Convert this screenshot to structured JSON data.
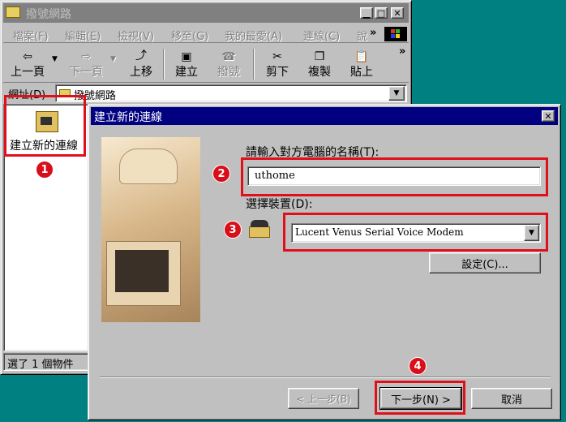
{
  "explorer": {
    "title": "撥號網路",
    "menu": [
      "檔案(F)",
      "編輯(E)",
      "檢視(V)",
      "移至(G)",
      "我的最愛(A)",
      "連線(C)",
      "說"
    ],
    "menu_more": "»",
    "toolbar": {
      "back": "上一頁",
      "forward": "下一頁",
      "up": "上移",
      "create": "建立",
      "dial": "撥號",
      "cut": "剪下",
      "copy": "複製",
      "paste": "貼上",
      "more": "»"
    },
    "address_label": "網址(D)",
    "address_value": "撥號網路",
    "icon_label": "建立新的連線",
    "status": "選了 1 個物件"
  },
  "dialog": {
    "title": "建立新的連線",
    "name_label": "請輸入對方電腦的名稱(T):",
    "name_value": "uthome",
    "device_label": "選擇裝置(D):",
    "device_value": "Lucent Venus Serial Voice Modem",
    "configure_button": "設定(C)...",
    "back_button": "< 上一步(B)",
    "next_button": "下一步(N) >",
    "cancel_button": "取消"
  },
  "badges": [
    "1",
    "2",
    "3",
    "4"
  ],
  "colors": {
    "title_active": "#000080",
    "title_inactive": "#808080",
    "highlight": "#e0101a",
    "desktop": "#008080"
  }
}
